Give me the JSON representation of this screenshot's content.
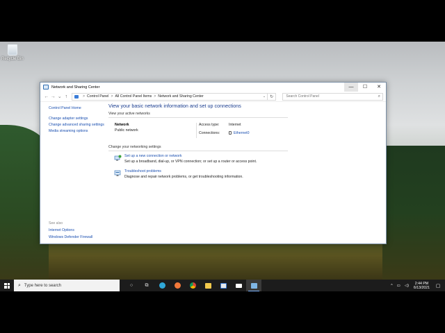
{
  "desktop": {
    "recycle_bin_label": "Recycle Bin"
  },
  "window": {
    "title": "Network and Sharing Center",
    "controls": {
      "minimize": "—",
      "maximize": "☐",
      "close": "✕"
    },
    "address": {
      "crumbs": [
        "Control Panel",
        "All Control Panel Items",
        "Network and Sharing Center"
      ],
      "separator": ">"
    },
    "search_placeholder": "Search Control Panel",
    "sidebar": {
      "home": "Control Panel Home",
      "links": [
        "Change adapter settings",
        "Change advanced sharing settings",
        "Media streaming options"
      ],
      "see_also": "See also",
      "bottom_links": [
        "Internet Options",
        "Windows Defender Firewall"
      ]
    },
    "main": {
      "heading": "View your basic network information and set up connections",
      "active_networks_label": "View your active networks",
      "network_name": "Network",
      "network_type": "Public network",
      "access_type_label": "Access type:",
      "access_type_value": "Internet",
      "connections_label": "Connections:",
      "connections_value": "Ethernet0",
      "change_settings_label": "Change your networking settings",
      "tasks": [
        {
          "title": "Set up a new connection or network",
          "desc": "Set up a broadband, dial-up, or VPN connection; or set up a router or access point."
        },
        {
          "title": "Troubleshoot problems",
          "desc": "Diagnose and repair network problems, or get troubleshooting information."
        }
      ]
    }
  },
  "taskbar": {
    "search_placeholder": "Type here to search",
    "time": "2:44 PM",
    "date": "6/13/2021"
  },
  "colors": {
    "link": "#1a4fb0",
    "heading": "#1a3d8f",
    "taskbar": "#1c1c1c"
  }
}
